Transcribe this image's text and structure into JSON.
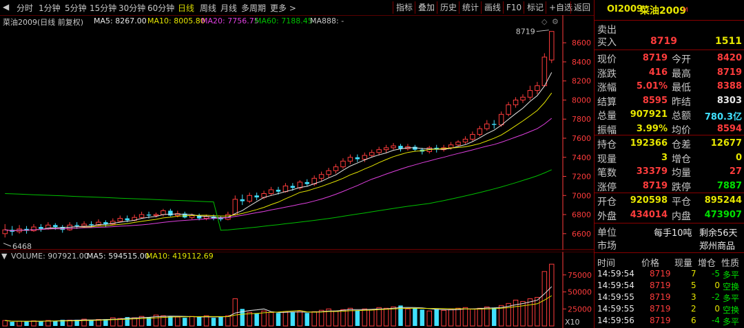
{
  "toolbar": {
    "left_items": [
      "分时",
      "1分钟",
      "5分钟",
      "15分钟",
      "30分钟",
      "60分钟",
      "日线",
      "周线",
      "月线",
      "多周期",
      "更多 >"
    ],
    "active": "日线",
    "right_items": [
      "指标",
      "叠加",
      "历史",
      "统计",
      "画线",
      "F10",
      "标记",
      "+自选",
      "返回"
    ]
  },
  "main_info": {
    "title": "菜油2009(日线 前复权)",
    "ma5": "MA5: 8267.00",
    "ma10": "MA10: 8005.80",
    "ma20": "MA20: 7756.75",
    "ma60": "MA60: 7188.45",
    "ma888": "MA888: -"
  },
  "colors": {
    "ma5": "#e8e8e8",
    "ma10": "#e6e600",
    "ma20": "#e040e0",
    "ma60": "#00c000",
    "up": "#ff3c3c",
    "down": "#40e0ff",
    "axis": "#ff3c3c"
  },
  "chart_data": [
    {
      "type": "candlestick",
      "y_ticks": [
        8600,
        8400,
        8200,
        8000,
        7800,
        7600,
        7400,
        7200,
        7000,
        6800,
        6600
      ],
      "ylim": [
        6440,
        8760
      ],
      "annotations": {
        "high_label": "8719",
        "low_label": "6468"
      },
      "candles": [
        [
          6600,
          6640,
          6560,
          6700
        ],
        [
          6640,
          6620,
          6580,
          6680
        ],
        [
          6620,
          6650,
          6600,
          6690
        ],
        [
          6650,
          6630,
          6600,
          6680
        ],
        [
          6630,
          6670,
          6620,
          6700
        ],
        [
          6670,
          6650,
          6620,
          6700
        ],
        [
          6650,
          6690,
          6640,
          6720
        ],
        [
          6690,
          6670,
          6640,
          6710
        ],
        [
          6670,
          6640,
          6610,
          6690
        ],
        [
          6640,
          6690,
          6630,
          6720
        ],
        [
          6690,
          6680,
          6650,
          6720
        ],
        [
          6680,
          6700,
          6660,
          6730
        ],
        [
          6700,
          6690,
          6660,
          6730
        ],
        [
          6690,
          6720,
          6680,
          6750
        ],
        [
          6720,
          6700,
          6670,
          6740
        ],
        [
          6700,
          6730,
          6690,
          6760
        ],
        [
          6730,
          6760,
          6720,
          6790
        ],
        [
          6760,
          6740,
          6720,
          6790
        ],
        [
          6740,
          6770,
          6730,
          6800
        ],
        [
          6770,
          6800,
          6760,
          6830
        ],
        [
          6800,
          6790,
          6760,
          6830
        ],
        [
          6790,
          6800,
          6770,
          6820
        ],
        [
          6800,
          6840,
          6780,
          6860
        ],
        [
          6840,
          6790,
          6780,
          6860
        ],
        [
          6790,
          6810,
          6770,
          6840
        ],
        [
          6810,
          6770,
          6760,
          6830
        ],
        [
          6770,
          6790,
          6750,
          6810
        ],
        [
          6790,
          6760,
          6740,
          6810
        ],
        [
          6760,
          6780,
          6740,
          6800
        ],
        [
          6780,
          6760,
          6740,
          6800
        ],
        [
          6760,
          6750,
          6730,
          6780
        ],
        [
          6750,
          6800,
          6740,
          6830
        ],
        [
          6800,
          6960,
          6790,
          7000
        ],
        [
          6960,
          6940,
          6900,
          7010
        ],
        [
          6940,
          7000,
          6920,
          7030
        ],
        [
          7000,
          6980,
          6950,
          7030
        ],
        [
          6980,
          7020,
          6960,
          7050
        ],
        [
          7020,
          7060,
          7000,
          7090
        ],
        [
          7060,
          7040,
          7010,
          7090
        ],
        [
          7040,
          7100,
          7030,
          7130
        ],
        [
          7100,
          7080,
          7050,
          7130
        ],
        [
          7080,
          7140,
          7060,
          7160
        ],
        [
          7140,
          7120,
          7100,
          7170
        ],
        [
          7120,
          7180,
          7100,
          7210
        ],
        [
          7180,
          7220,
          7150,
          7250
        ],
        [
          7220,
          7260,
          7190,
          7290
        ],
        [
          7260,
          7300,
          7230,
          7330
        ],
        [
          7300,
          7360,
          7280,
          7390
        ],
        [
          7360,
          7400,
          7330,
          7430
        ],
        [
          7400,
          7380,
          7350,
          7430
        ],
        [
          7380,
          7420,
          7350,
          7450
        ],
        [
          7420,
          7450,
          7400,
          7480
        ],
        [
          7450,
          7480,
          7420,
          7510
        ],
        [
          7480,
          7500,
          7450,
          7530
        ],
        [
          7500,
          7520,
          7480,
          7550
        ],
        [
          7520,
          7490,
          7460,
          7540
        ],
        [
          7490,
          7510,
          7470,
          7540
        ],
        [
          7510,
          7480,
          7460,
          7530
        ],
        [
          7480,
          7460,
          7430,
          7500
        ],
        [
          7460,
          7500,
          7440,
          7520
        ],
        [
          7500,
          7480,
          7450,
          7530
        ],
        [
          7480,
          7500,
          7460,
          7530
        ],
        [
          7500,
          7530,
          7480,
          7560
        ],
        [
          7530,
          7560,
          7510,
          7580
        ],
        [
          7560,
          7590,
          7540,
          7620
        ],
        [
          7590,
          7640,
          7570,
          7670
        ],
        [
          7640,
          7700,
          7620,
          7730
        ],
        [
          7700,
          7750,
          7680,
          7790
        ],
        [
          7750,
          7740,
          7700,
          7790
        ],
        [
          7740,
          7850,
          7720,
          7880
        ],
        [
          7850,
          7950,
          7830,
          7980
        ],
        [
          7950,
          8000,
          7920,
          8030
        ],
        [
          8000,
          8030,
          7970,
          8060
        ],
        [
          8030,
          8100,
          8000,
          8150
        ],
        [
          8100,
          8150,
          8060,
          8190
        ],
        [
          8150,
          8450,
          8140,
          8490
        ],
        [
          8420,
          8719,
          8388,
          8719
        ]
      ],
      "volume": {
        "y_ticks": [
          75000,
          50000,
          25000
        ],
        "ylim": [
          0,
          95000
        ],
        "multiplier_label": "X10",
        "values": [
          8000,
          6000,
          7000,
          6500,
          7500,
          7000,
          8000,
          7500,
          9000,
          8500,
          9000,
          10000,
          8000,
          9500,
          10000,
          12000,
          11000,
          13000,
          12000,
          14000,
          13000,
          16000,
          15000,
          14000,
          13000,
          12000,
          14000,
          13000,
          15000,
          12000,
          13000,
          15000,
          40000,
          25000,
          20000,
          18000,
          22000,
          20000,
          19000,
          21000,
          20000,
          22000,
          19000,
          21000,
          23000,
          25000,
          22000,
          24000,
          26000,
          23000,
          25000,
          24000,
          27000,
          26000,
          28000,
          30000,
          25000,
          26000,
          24000,
          22000,
          25000,
          23000,
          24000,
          26000,
          27000,
          25000,
          26000,
          28000,
          27000,
          30000,
          33000,
          38000,
          36000,
          40000,
          42000,
          80000,
          90792
        ],
        "info": {
          "label": "VOLUME: 907921.00",
          "ma5": "MA5: 594515.00",
          "ma10": "MA10: 419112.69"
        }
      }
    }
  ],
  "right_panel": {
    "code": "OI2009",
    "name": "菜油2009",
    "tag": "M",
    "sell_label": "卖出",
    "buy_label": "买入",
    "buy_price": "8719",
    "buy_volume": "1511",
    "rows": [
      {
        "l1": "现价",
        "v1": "8719",
        "c1": "red",
        "l2": "今开",
        "v2": "8420",
        "c2": "red"
      },
      {
        "l1": "涨跌",
        "v1": "416",
        "c1": "red",
        "l2": "最高",
        "v2": "8719",
        "c2": "red"
      },
      {
        "l1": "涨幅",
        "v1": "5.01%",
        "c1": "red",
        "l2": "最低",
        "v2": "8388",
        "c2": "red"
      },
      {
        "l1": "结算",
        "v1": "8595",
        "c1": "red",
        "l2": "昨结",
        "v2": "8303",
        "c2": "white"
      },
      {
        "l1": "总量",
        "v1": "907921",
        "c1": "yellow",
        "l2": "总额",
        "v2": "780.3亿",
        "c2": "cyan"
      },
      {
        "l1": "振幅",
        "v1": "3.99%",
        "c1": "yellow",
        "l2": "均价",
        "v2": "8594",
        "c2": "red"
      }
    ],
    "rows2": [
      {
        "l1": "持仓",
        "v1": "192366",
        "c1": "yellow",
        "l2": "仓差",
        "v2": "12677",
        "c2": "yellow"
      },
      {
        "l1": "现量",
        "v1": "3",
        "c1": "yellow",
        "l2": "增仓",
        "v2": "0",
        "c2": "yellow"
      },
      {
        "l1": "笔数",
        "v1": "33379",
        "c1": "red",
        "l2": "均量",
        "v2": "27",
        "c2": "red"
      },
      {
        "l1": "涨停",
        "v1": "8719",
        "c1": "red",
        "l2": "跌停",
        "v2": "7887",
        "c2": "green"
      }
    ],
    "rows3": [
      {
        "l1": "开仓",
        "v1": "920598",
        "c1": "yellow",
        "l2": "平仓",
        "v2": "895244",
        "c2": "yellow"
      },
      {
        "l1": "外盘",
        "v1": "434014",
        "c1": "red",
        "l2": "内盘",
        "v2": "473907",
        "c2": "green"
      }
    ],
    "unit_label": "单位",
    "unit_value": "每手10吨",
    "remain_value": "剩余56天",
    "market_label": "市场",
    "market_value": "郑州商品",
    "ticks_header": [
      "时间",
      "价格",
      "现量",
      "增仓",
      "性质"
    ],
    "ticks": [
      {
        "time": "14:59:54",
        "price": "8719",
        "vol": "7",
        "chg": "-5",
        "kind": "多平",
        "kc": "green",
        "cc": "green"
      },
      {
        "time": "14:59:54",
        "price": "8719",
        "vol": "5",
        "chg": "0",
        "kind": "空换",
        "kc": "green",
        "cc": "yellow"
      },
      {
        "time": "14:59:55",
        "price": "8719",
        "vol": "3",
        "chg": "-2",
        "kind": "多平",
        "kc": "green",
        "cc": "green"
      },
      {
        "time": "14:59:55",
        "price": "8719",
        "vol": "2",
        "chg": "0",
        "kind": "空换",
        "kc": "green",
        "cc": "yellow"
      },
      {
        "time": "14:59:56",
        "price": "8719",
        "vol": "6",
        "chg": "-4",
        "kind": "多平",
        "kc": "green",
        "cc": "green"
      }
    ]
  }
}
